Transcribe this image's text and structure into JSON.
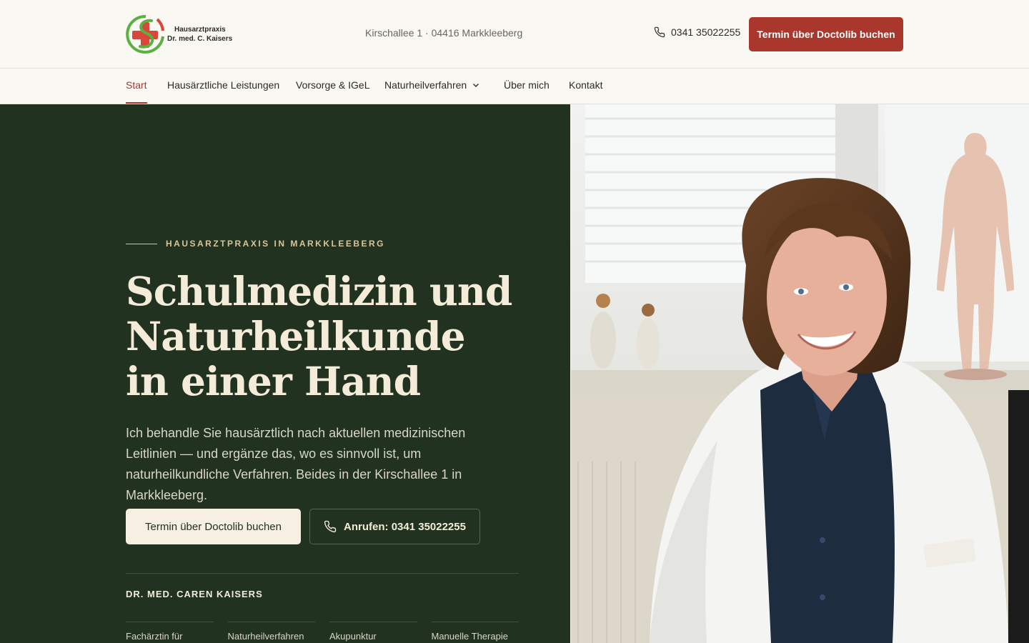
{
  "header": {
    "logo": {
      "line1": "Hausarztpraxis",
      "line2": "Dr. med. C. Kaisers"
    },
    "address": "Kirschallee 1 · 04416 Markkleeberg",
    "phone": "0341 35022255",
    "book_label": "Termin über Doctolib buchen"
  },
  "nav": {
    "items": [
      {
        "label": "Start",
        "active": true
      },
      {
        "label": "Hausärztliche Leistungen"
      },
      {
        "label": "Vorsorge & IGeL"
      },
      {
        "label": "Naturheilverfahren",
        "has_dropdown": true
      },
      {
        "label": "Über mich"
      },
      {
        "label": "Kontakt"
      }
    ]
  },
  "hero": {
    "eyebrow": "HAUSARZTPRAXIS IN MARKKLEEBERG",
    "headline_1": "Schulmedizin und",
    "headline_2": "Naturheilkunde",
    "headline_3": "in einer Hand",
    "lead": "Ich behandle Sie hausärztlich nach aktuellen medizinischen Leitlinien — und ergänze das, wo es sinnvoll ist, um naturheilkundliche Verfahren. Beides in der Kirschallee 1 in Markkleeberg.",
    "primary_label": "Termin über Doctolib buchen",
    "call_label": "Anrufen: 0341 35022255",
    "doctor_name": "DR. MED. CAREN KAISERS",
    "qualifications": [
      "Fachärztin für",
      "Naturheilverfahren",
      "Akupunktur",
      "Manuelle Therapie"
    ],
    "photo_label": "Dr. Caren Kaisers"
  },
  "colors": {
    "accent": "#a9372c",
    "hero_bg": "#213320",
    "cream": "#f6efe2",
    "gold": "#d8c49a"
  }
}
